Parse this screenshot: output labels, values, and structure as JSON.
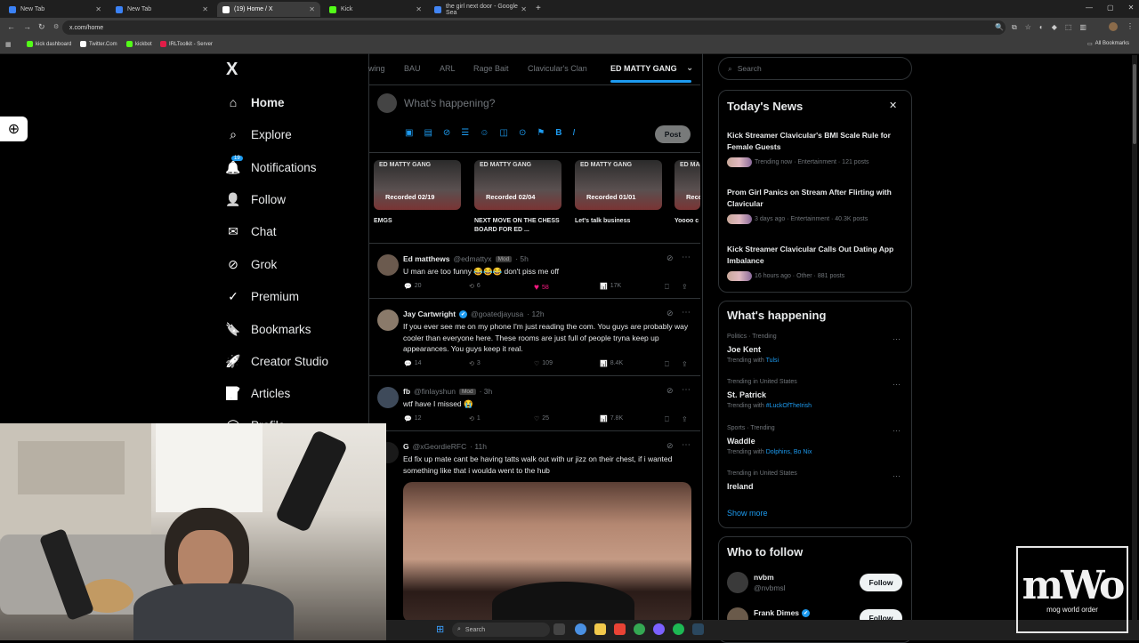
{
  "browser": {
    "tabs": [
      {
        "title": "New Tab",
        "active": false,
        "color": "#3b82f6"
      },
      {
        "title": "New Tab",
        "active": false,
        "color": "#3b82f6"
      },
      {
        "title": "(19) Home / X",
        "active": true,
        "color": "#ffffff"
      },
      {
        "title": "Kick",
        "active": false,
        "color": "#53fc18"
      },
      {
        "title": "the girl next door - Google Sea",
        "active": false,
        "color": "#4285f4"
      }
    ],
    "url": "x.com/home",
    "bookmarks": [
      {
        "label": "kick dashboard",
        "color": "#53fc18"
      },
      {
        "label": "Twitter.Com",
        "color": "#ffffff"
      },
      {
        "label": "kickbot",
        "color": "#53fc18"
      },
      {
        "label": "IRLToolkit - Server",
        "color": "#e11d48"
      }
    ],
    "all_bookmarks": "All Bookmarks"
  },
  "nav": {
    "logo": "X",
    "items": [
      {
        "label": "Home",
        "icon": "home-icon"
      },
      {
        "label": "Explore",
        "icon": "search-icon"
      },
      {
        "label": "Notifications",
        "icon": "bell-icon",
        "badge": "19"
      },
      {
        "label": "Follow",
        "icon": "follow-icon"
      },
      {
        "label": "Chat",
        "icon": "mail-icon"
      },
      {
        "label": "Grok",
        "icon": "grok-icon"
      },
      {
        "label": "Premium",
        "icon": "verified-icon"
      },
      {
        "label": "Bookmarks",
        "icon": "bookmark-icon"
      },
      {
        "label": "Creator Studio",
        "icon": "rocket-icon"
      },
      {
        "label": "Articles",
        "icon": "article-icon"
      },
      {
        "label": "Profile",
        "icon": "profile-icon"
      }
    ]
  },
  "feed": {
    "tabs": [
      "wing",
      "BAU",
      "ARL",
      "Rage Bait",
      "Clavicular's Clan",
      "ED MATTY GANG"
    ],
    "active_tab": "ED MATTY GANG",
    "compose_placeholder": "What's happening?",
    "post_button": "Post",
    "videos": [
      {
        "header": "ED MATTY GANG",
        "label": "Recorded 02/19",
        "caption": "EMGS"
      },
      {
        "header": "ED MATTY GANG",
        "label": "Recorded 02/04",
        "caption": "NEXT MOVE ON THE CHESS BOARD FOR ED ..."
      },
      {
        "header": "ED MATTY GANG",
        "label": "Recorded 01/01",
        "caption": "Let's talk business"
      },
      {
        "header": "ED MATTY G",
        "label": "Reco",
        "caption": "Yoooo c"
      }
    ],
    "tweets": [
      {
        "name": "Ed matthews",
        "handle": "@edmattyx",
        "mod": "Mod",
        "time": "· 5h",
        "text": "U man are too funny 😂😂😂 don't piss me off",
        "replies": "20",
        "reposts": "6",
        "likes": "58",
        "views": "17K",
        "liked": true
      },
      {
        "name": "Jay Cartwright",
        "handle": "@goatedjayusa",
        "mod": "",
        "time": "· 12h",
        "text": "If you ever see me on my phone I'm just reading the com. You guys are probably way cooler than everyone here. These rooms are just full of people tryna keep up appearances. You guys keep it real.",
        "replies": "14",
        "reposts": "3",
        "likes": "109",
        "views": "8.4K",
        "liked": false
      },
      {
        "name": "fb",
        "handle": "@finlayshun",
        "mod": "Mod",
        "time": "· 3h",
        "text": "wtf have I missed 😭",
        "replies": "12",
        "reposts": "1",
        "likes": "25",
        "views": "7.8K",
        "liked": false
      },
      {
        "name": "G",
        "handle": "@xGeordieRFC",
        "mod": "",
        "time": "· 11h",
        "text": "Ed fix up mate cant be having tatts walk out with ur jizz on their chest, if i wanted something like that i woulda went to the hub",
        "replies": "",
        "reposts": "",
        "likes": "",
        "views": "",
        "liked": false
      }
    ]
  },
  "right": {
    "search_placeholder": "Search",
    "news_title": "Today's News",
    "news": [
      {
        "title": "Kick Streamer Clavicular's BMI Scale Rule for Female Guests",
        "meta": "Trending now · Entertainment · 121 posts"
      },
      {
        "title": "Prom Girl Panics on Stream After Flirting with Clavicular",
        "meta": "3 days ago · Entertainment · 40.3K posts"
      },
      {
        "title": "Kick Streamer Clavicular Calls Out Dating App Imbalance",
        "meta": "16 hours ago · Other · 881 posts"
      }
    ],
    "happening_title": "What's happening",
    "trends": [
      {
        "meta": "Politics · Trending",
        "name": "Joe Kent",
        "with_label": "Trending with",
        "with": "Tulsi"
      },
      {
        "meta": "Trending in United States",
        "name": "St. Patrick",
        "with_label": "Trending with",
        "with": "#LuckOfTheIrish"
      },
      {
        "meta": "Sports · Trending",
        "name": "Waddle",
        "with_label": "Trending with",
        "with": "Dolphins, Bo Nix"
      },
      {
        "meta": "Trending in United States",
        "name": "Ireland",
        "with_label": "",
        "with": ""
      }
    ],
    "show_more": "Show more",
    "follow_title": "Who to follow",
    "follow": [
      {
        "name": "nvbm",
        "handle": "@nvbmsl",
        "button": "Follow"
      },
      {
        "name": "Frank Dimes",
        "handle": "",
        "button": "Follow"
      }
    ]
  },
  "overlay": {
    "watermark_line1": "mWo",
    "watermark_line2": "mog world order"
  },
  "taskbar": {
    "search": "Search"
  }
}
